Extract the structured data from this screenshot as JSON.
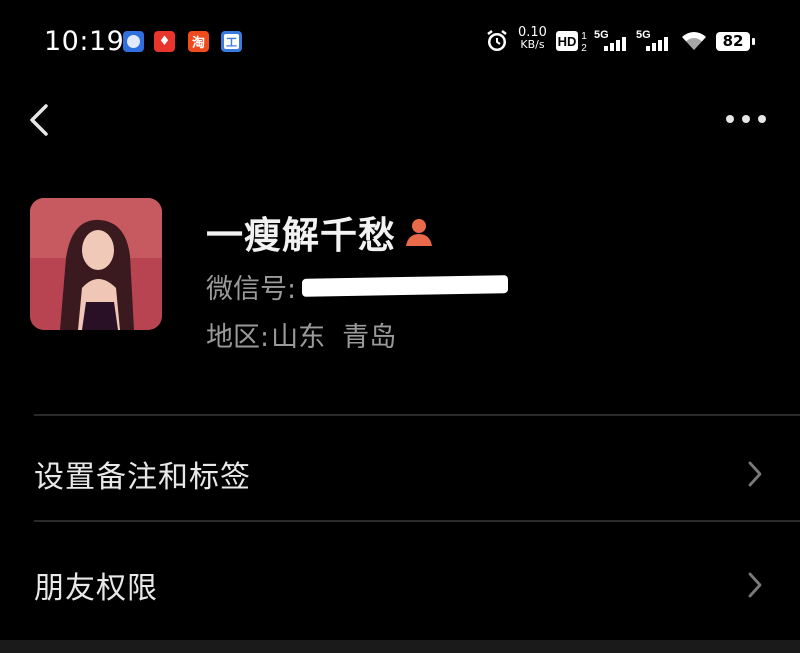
{
  "status_bar": {
    "time": "10:19",
    "net_speed_value": "0.10",
    "net_speed_unit": "KB/s",
    "hd_label": "HD",
    "signal_1_label": "5G",
    "signal_2_label": "5G",
    "battery": "82",
    "app_icons": [
      "baidu-map-icon",
      "app-red-icon",
      "taobao-icon",
      "gongshang-icon"
    ]
  },
  "nav": {
    "back_icon": "chevron-left-icon",
    "more_icon": "more-dots-icon"
  },
  "profile": {
    "nickname": "一瘦解千愁",
    "wechat_id_label": "微信号:",
    "region_label": "地区:",
    "region_value": "山东  青岛",
    "gender_icon": "female-icon"
  },
  "menu": {
    "items": [
      {
        "label": "设置备注和标签"
      },
      {
        "label": "朋友权限"
      }
    ]
  },
  "colors": {
    "background": "#000000",
    "text_primary": "#e8e8e8",
    "text_secondary": "#9a9a9a",
    "divider": "#2a2a2a",
    "gender_female": "#e86a4a"
  }
}
